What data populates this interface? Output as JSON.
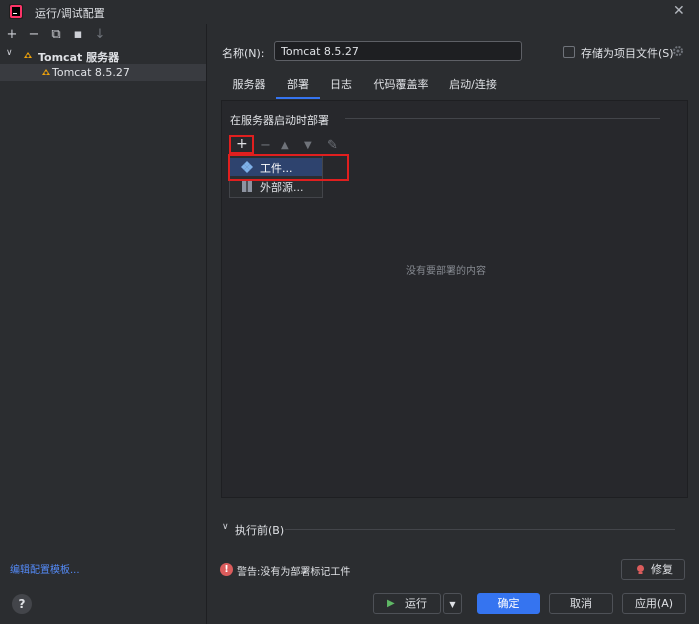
{
  "window": {
    "title": "运行/调试配置",
    "close": "✕"
  },
  "left": {
    "toolbar": [
      "+",
      "−",
      "⧉",
      "▪",
      "↓"
    ],
    "tree": {
      "group": "Tomcat 服务器",
      "item": "Tomcat 8.5.27"
    },
    "edit_templates": "编辑配置模板..."
  },
  "form": {
    "name_label": "名称(N):",
    "name_value": "Tomcat 8.5.27",
    "store_label": "存储为项目文件(S)"
  },
  "tabs": [
    {
      "label": "服务器",
      "active": false
    },
    {
      "label": "部署",
      "active": true
    },
    {
      "label": "日志",
      "active": false
    },
    {
      "label": "代码覆盖率",
      "active": false
    },
    {
      "label": "启动/连接",
      "active": false
    }
  ],
  "deploy": {
    "section_title": "在服务器启动时部署",
    "toolbar": [
      "+",
      "−",
      "▲",
      "▼",
      "✎"
    ],
    "menu": [
      {
        "label": "工件..."
      },
      {
        "label": "外部源..."
      }
    ],
    "empty_text": "没有要部署的内容"
  },
  "before_launch": {
    "label": "执行前(B)"
  },
  "warning": {
    "text": "警告:没有为部署标记工件",
    "fix_label": "修复"
  },
  "buttons": {
    "help": "?",
    "run": "运行",
    "ok": "确定",
    "cancel": "取消",
    "apply": "应用(A)"
  },
  "colors": {
    "accent": "#3574f0",
    "highlight_box": "#e01f1f",
    "warning": "#db5c5c"
  }
}
